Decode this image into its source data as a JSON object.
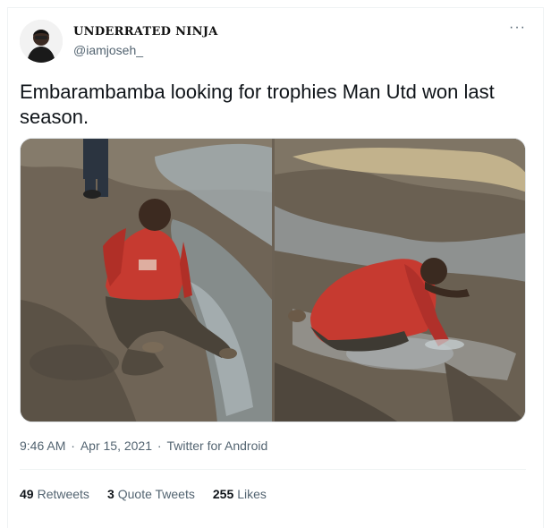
{
  "author": {
    "display_name": "UNDERRATED NINJA",
    "handle": "@iamjoseh_"
  },
  "more_label": "···",
  "tweet": {
    "text": "Embarambamba looking for trophies Man Utd won last season."
  },
  "meta": {
    "time": "9:46 AM",
    "sep1": " · ",
    "date": "Apr 15, 2021",
    "sep2": " · ",
    "source": "Twitter for Android"
  },
  "stats": {
    "retweets_count": "49",
    "retweets_label": "Retweets",
    "quotes_count": "3",
    "quotes_label": "Quote Tweets",
    "likes_count": "255",
    "likes_label": "Likes"
  }
}
